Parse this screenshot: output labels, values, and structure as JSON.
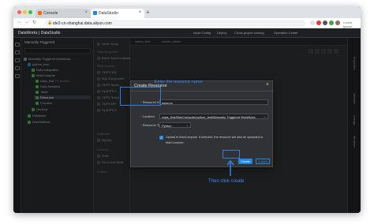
{
  "browser": {
    "tabs": [
      {
        "title": "Console",
        "active": false,
        "favicon_color": "#ff6a00"
      },
      {
        "title": "DataStudio",
        "active": true,
        "favicon_color": "#1e88e5"
      }
    ],
    "url": "ide2-cn-shanghai.data.aliyun.com",
    "profile_label": "Lorem Ipsum"
  },
  "app": {
    "brand": "DataWorks",
    "module": "DataStudio",
    "toolbar": [
      "Node Config",
      "Deploy",
      "Cross-project cloning",
      "Operation Center"
    ]
  },
  "sidebar": {
    "header": "Manually Triggered",
    "tree": [
      {
        "label": "Manually Triggered Workflows",
        "level": 0
      },
      {
        "label": "python_test",
        "level": 1
      },
      {
        "label": "Data Integration",
        "level": 2
      },
      {
        "label": "MaxCompute",
        "level": 2
      },
      {
        "label": "odps_first",
        "level": 3,
        "suffix": "Production"
      },
      {
        "label": "Data Analytics",
        "level": 3
      },
      {
        "label": "Table",
        "level": 3
      },
      {
        "label": "Resource",
        "level": 3,
        "selected": true
      },
      {
        "label": "Function",
        "level": 3
      },
      {
        "label": "General",
        "level": 2
      },
      {
        "label": "Database",
        "level": 1
      },
      {
        "label": "UserDefined",
        "level": 1
      }
    ]
  },
  "nodes": {
    "items": [
      "Node Group",
      "Data Integration",
      "Batch Synchronization",
      "MaxCompute",
      "ODPS SQL",
      "SQL Component",
      "ODPS Spark",
      "PyODPS 2",
      "ODPS Script",
      "ODPS MR",
      "PyODPS 3",
      "Database",
      "MySQL",
      "General",
      "Shell",
      "Zero-Load Node",
      "Custom"
    ]
  },
  "editor": {
    "tabs": [
      "select_test",
      "create_tables"
    ]
  },
  "right_rail": [
    "Properties",
    "Versions",
    "Lineage",
    "Structure"
  ],
  "dialog": {
    "title": "Create Resource",
    "resource_name_label": "Resource Name",
    "resource_name_value": "www.py",
    "location_label": "Location",
    "location_value": "odps_first/MaxCompute/python_test/Manually Triggered Workflows",
    "resource_type_label": "Resource Type",
    "resource_type_value": "Python",
    "upload_checked": true,
    "upload_text": "Upload to MaxCompute",
    "upload_note": "If selected, the resource will also be uploaded to",
    "upload_note_2": "MaxCompute.",
    "create_label": "Create",
    "cancel_label": "Cancel"
  },
  "annotations": {
    "enter_name": "Enter the resource name",
    "then_click": "Then click create",
    "color": "#2f7de1"
  }
}
